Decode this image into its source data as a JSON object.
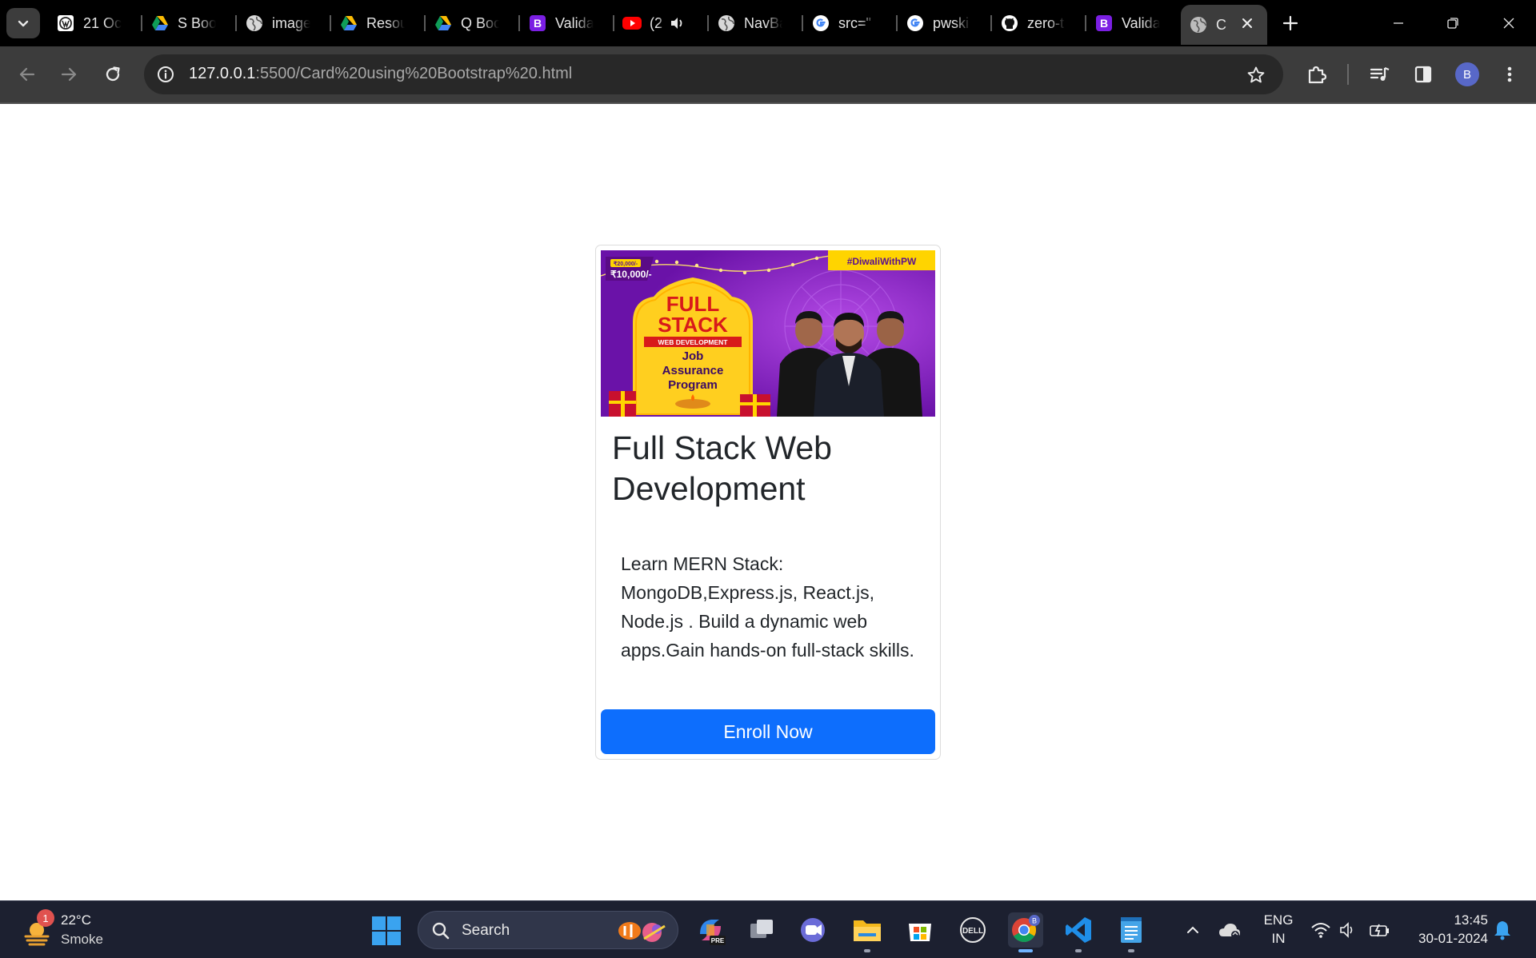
{
  "browser": {
    "tabs": [
      {
        "title": "21 Oc",
        "icon": "wordpress-icon"
      },
      {
        "title": "S Boo",
        "icon": "google-drive-icon"
      },
      {
        "title": "image",
        "icon": "globe-icon"
      },
      {
        "title": "Resou",
        "icon": "google-drive-icon"
      },
      {
        "title": "Q Boo",
        "icon": "google-drive-icon"
      },
      {
        "title": "Valida",
        "icon": "bootstrap-icon"
      },
      {
        "title": "(2",
        "icon": "youtube-icon"
      },
      {
        "title": "NavBa",
        "icon": "globe-icon"
      },
      {
        "title": "src=\"",
        "icon": "google-icon"
      },
      {
        "title": "pwski",
        "icon": "google-icon"
      },
      {
        "title": "zero-t",
        "icon": "github-icon"
      },
      {
        "title": "Valida",
        "icon": "bootstrap-icon"
      }
    ],
    "active_tab": {
      "title": "C",
      "icon": "globe-icon"
    },
    "url_host": "127.0.0.1",
    "url_path": ":5500/Card%20using%20Bootstrap%20.html",
    "profile_initial": "B",
    "colors": {
      "tabstrip": "#000000",
      "toolbar": "#3c3c3c",
      "omnibox": "#282828",
      "profile": "#5868c8"
    }
  },
  "card": {
    "image_alt": "Full Stack Web Development Job Assurance Program banner",
    "banner": {
      "hashtag": "#DiwaliWithPW",
      "old_price": "₹20,000/-",
      "price": "₹10,000/-",
      "line1": "FULL",
      "line2": "STACK",
      "ribbon": "WEB DEVELOPMENT",
      "line3": "Job",
      "line4": "Assurance",
      "line5": "Program"
    },
    "title": "Full Stack Web Development",
    "text": "Learn MERN Stack: MongoDB,Express.js, React.js, Node.js . Build a dynamic web apps.Gain hands-on full-stack skills.",
    "button_label": "Enroll Now",
    "colors": {
      "button": "#0d6efd",
      "text": "#212529"
    }
  },
  "taskbar": {
    "weather_temp": "22°C",
    "weather_desc": "Smoke",
    "weather_badge": "1",
    "search_placeholder": "Search",
    "apps": [
      "copilot-icon",
      "task-view-icon",
      "teams-icon",
      "file-explorer-icon",
      "microsoft-store-icon",
      "dell-icon",
      "chrome-icon",
      "vscode-icon",
      "notepad-icon"
    ],
    "copilot_badge": "PRE",
    "lang_line1": "ENG",
    "lang_line2": "IN",
    "time": "13:45",
    "date": "30-01-2024"
  }
}
